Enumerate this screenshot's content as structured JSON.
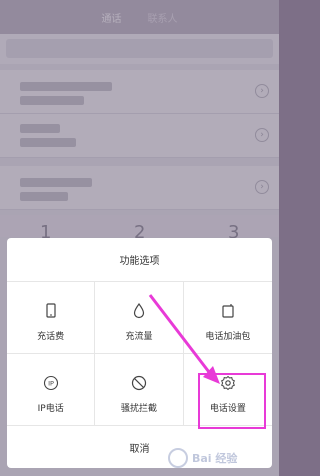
{
  "header": {
    "tabs": [
      {
        "label": "通话"
      },
      {
        "label": "联系人"
      }
    ]
  },
  "keypad": {
    "digits": [
      "1",
      "2",
      "3"
    ]
  },
  "sheet": {
    "title": "功能选项",
    "items": [
      {
        "label": "充话费",
        "icon": "phone-bill-icon"
      },
      {
        "label": "充流量",
        "icon": "droplet-icon"
      },
      {
        "label": "电话加油包",
        "icon": "battery-pack-icon"
      },
      {
        "label": "IP电话",
        "icon": "ip-icon"
      },
      {
        "label": "骚扰拦截",
        "icon": "block-icon"
      },
      {
        "label": "电话设置",
        "icon": "gear-icon"
      }
    ],
    "cancel_label": "取消"
  },
  "annotation": {
    "highlight_color": "#e83ad7",
    "highlighted_item": "电话设置"
  },
  "watermark": {
    "text": "Bai 经验"
  }
}
